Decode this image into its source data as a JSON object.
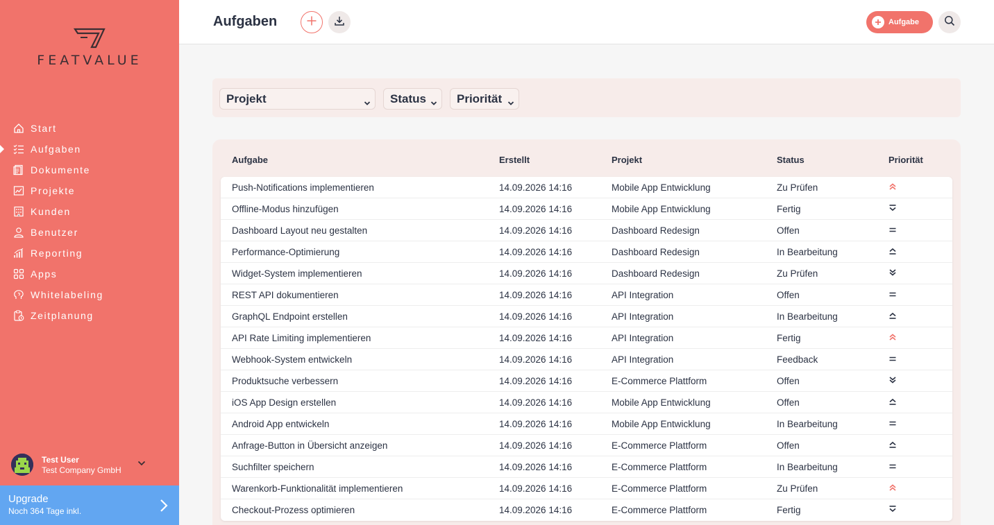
{
  "app": {
    "brand": "FEATVALUE"
  },
  "sidebar": {
    "items": [
      {
        "label": "Start",
        "icon": "home-icon",
        "active": false
      },
      {
        "label": "Aufgaben",
        "icon": "task-list-icon",
        "active": true
      },
      {
        "label": "Dokumente",
        "icon": "document-icon",
        "active": false
      },
      {
        "label": "Projekte",
        "icon": "project-icon",
        "active": false
      },
      {
        "label": "Kunden",
        "icon": "building-icon",
        "active": false
      },
      {
        "label": "Benutzer",
        "icon": "user-icon",
        "active": false
      },
      {
        "label": "Reporting",
        "icon": "chart-icon",
        "active": false
      },
      {
        "label": "Apps",
        "icon": "apps-icon",
        "active": false
      },
      {
        "label": "Whitelabeling",
        "icon": "brain-icon",
        "active": false
      },
      {
        "label": "Zeitplanung",
        "icon": "clipboard-clock-icon",
        "active": false
      }
    ],
    "user": {
      "name": "Test User",
      "company": "Test Company GmbH"
    },
    "upgrade": {
      "title": "Upgrade",
      "subtitle": "Noch 364 Tage inkl."
    }
  },
  "header": {
    "title": "Aufgaben",
    "new_task_label": "Aufgabe"
  },
  "filters": {
    "projekt": "Projekt",
    "status": "Status",
    "prioritaet": "Priorität"
  },
  "table": {
    "columns": [
      "Aufgabe",
      "Erstellt",
      "Projekt",
      "Status",
      "Priorität"
    ],
    "rows": [
      {
        "aufgabe": "Push-Notifications implementieren",
        "erstellt": "14.09.2026 14:16",
        "projekt": "Mobile App Entwicklung",
        "status": "Zu Prüfen",
        "prio": "highest"
      },
      {
        "aufgabe": "Offline-Modus hinzufügen",
        "erstellt": "14.09.2026 14:16",
        "projekt": "Mobile App Entwicklung",
        "status": "Fertig",
        "prio": "low"
      },
      {
        "aufgabe": "Dashboard Layout neu gestalten",
        "erstellt": "14.09.2026 14:16",
        "projekt": "Dashboard Redesign",
        "status": "Offen",
        "prio": "medium"
      },
      {
        "aufgabe": "Performance-Optimierung",
        "erstellt": "14.09.2026 14:16",
        "projekt": "Dashboard Redesign",
        "status": "In Bearbeitung",
        "prio": "high"
      },
      {
        "aufgabe": "Widget-System implementieren",
        "erstellt": "14.09.2026 14:16",
        "projekt": "Dashboard Redesign",
        "status": "Zu Prüfen",
        "prio": "lowest"
      },
      {
        "aufgabe": "REST API dokumentieren",
        "erstellt": "14.09.2026 14:16",
        "projekt": "API Integration",
        "status": "Offen",
        "prio": "medium"
      },
      {
        "aufgabe": "GraphQL Endpoint erstellen",
        "erstellt": "14.09.2026 14:16",
        "projekt": "API Integration",
        "status": "In Bearbeitung",
        "prio": "high"
      },
      {
        "aufgabe": "API Rate Limiting implementieren",
        "erstellt": "14.09.2026 14:16",
        "projekt": "API Integration",
        "status": "Fertig",
        "prio": "highest"
      },
      {
        "aufgabe": "Webhook-System entwickeln",
        "erstellt": "14.09.2026 14:16",
        "projekt": "API Integration",
        "status": "Feedback",
        "prio": "medium"
      },
      {
        "aufgabe": "Produktsuche verbessern",
        "erstellt": "14.09.2026 14:16",
        "projekt": "E-Commerce Plattform",
        "status": "Offen",
        "prio": "lowest"
      },
      {
        "aufgabe": "iOS App Design erstellen",
        "erstellt": "14.09.2026 14:16",
        "projekt": "Mobile App Entwicklung",
        "status": "Offen",
        "prio": "high"
      },
      {
        "aufgabe": "Android App entwickeln",
        "erstellt": "14.09.2026 14:16",
        "projekt": "Mobile App Entwicklung",
        "status": "In Bearbeitung",
        "prio": "medium"
      },
      {
        "aufgabe": "Anfrage-Button in Übersicht anzeigen",
        "erstellt": "14.09.2026 14:16",
        "projekt": "E-Commerce Plattform",
        "status": "Offen",
        "prio": "high"
      },
      {
        "aufgabe": "Suchfilter speichern",
        "erstellt": "14.09.2026 14:16",
        "projekt": "E-Commerce Plattform",
        "status": "In Bearbeitung",
        "prio": "medium"
      },
      {
        "aufgabe": "Warenkorb-Funktionalität implementieren",
        "erstellt": "14.09.2026 14:16",
        "projekt": "E-Commerce Plattform",
        "status": "Zu Prüfen",
        "prio": "highest"
      },
      {
        "aufgabe": "Checkout-Prozess optimieren",
        "erstellt": "14.09.2026 14:16",
        "projekt": "E-Commerce Plattform",
        "status": "Fertig",
        "prio": "low"
      }
    ]
  },
  "colors": {
    "accent": "#f1736b",
    "upgrade": "#62a6f1",
    "text": "#2b3243",
    "panel": "#f7ecea"
  }
}
